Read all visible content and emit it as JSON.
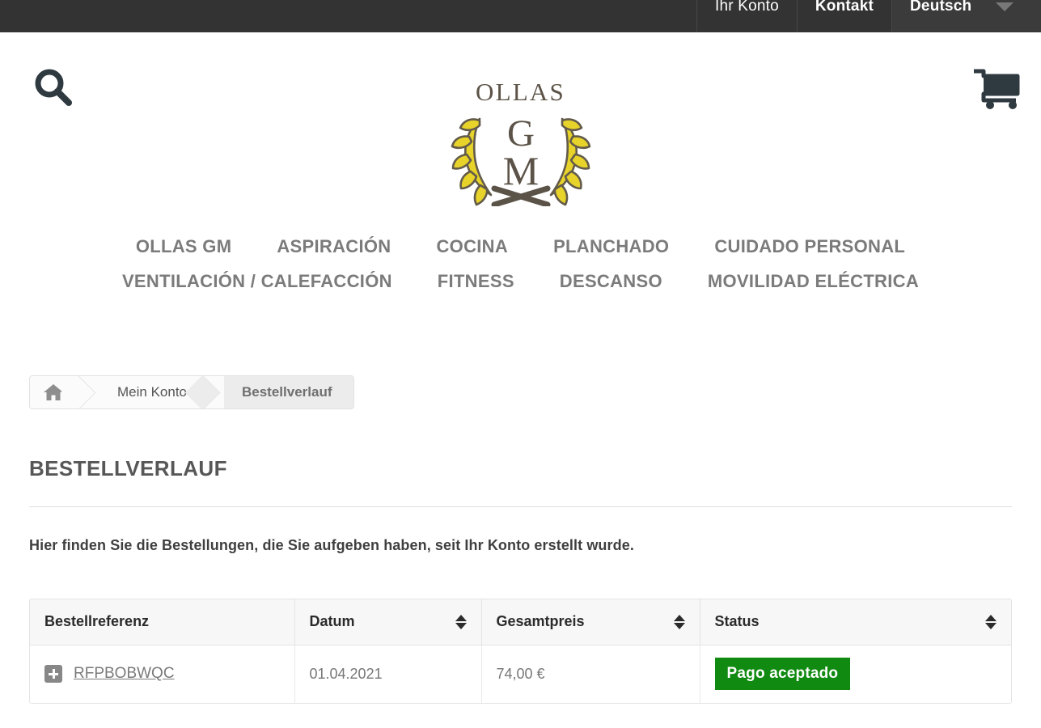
{
  "topbar": {
    "account_label": "Ihr Konto",
    "contact_label": "Kontakt",
    "language_label": "Deutsch",
    "background_color": "#333333"
  },
  "header": {
    "search_icon": "search-icon",
    "cart_icon": "shopping-cart-icon",
    "logo": {
      "line1": "OLLAS",
      "line2": "G",
      "line3": "M",
      "wreath_color": "#e8d32a",
      "text_color": "#5b5347"
    }
  },
  "nav": {
    "rows": [
      [
        "OLLAS GM",
        "ASPIRACIÓN",
        "COCINA",
        "PLANCHADO",
        "CUIDADO PERSONAL"
      ],
      [
        "VENTILACIÓN / CALEFACCIÓN",
        "FITNESS",
        "DESCANSO",
        "MOVILIDAD ELÉCTRICA"
      ]
    ]
  },
  "breadcrumb": {
    "home_icon": "home-icon",
    "items": [
      {
        "label": "Mein Konto",
        "active": false
      },
      {
        "label": "Bestellverlauf",
        "active": true
      }
    ]
  },
  "page": {
    "title": "BESTELLVERLAUF",
    "intro": "Hier finden Sie die Bestellungen, die Sie aufgeben haben, seit Ihr Konto erstellt wurde."
  },
  "orders_table": {
    "columns": [
      {
        "label": "Bestellreferenz",
        "sortable": false
      },
      {
        "label": "Datum",
        "sortable": true
      },
      {
        "label": "Gesamtpreis",
        "sortable": true
      },
      {
        "label": "Status",
        "sortable": true
      }
    ],
    "rows": [
      {
        "reference": "RFPBOBWQC",
        "date": "01.04.2021",
        "total": "74,00 €",
        "status": "Pago aceptado",
        "status_color": "#108a10"
      }
    ]
  }
}
